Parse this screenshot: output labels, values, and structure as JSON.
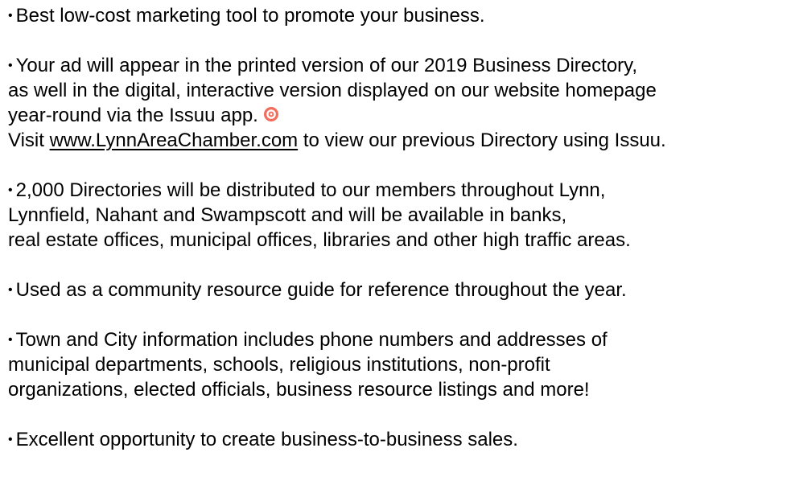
{
  "bullet": "•",
  "icon_color": "#f36d5d",
  "paragraphs": {
    "p1": {
      "l1": "Best low-cost marketing tool to promote your business."
    },
    "p2": {
      "l1": "Your ad will appear in the printed version of our 2019 Business Directory,",
      "l2": "as well in the digital, interactive version displayed on our website homepage",
      "l3": "year-round via the Issuu app.",
      "l3_icon": "issuu-icon",
      "l4_before": "Visit ",
      "l4_link": "www.LynnAreaChamber.com",
      "l4_after": " to view our previous Directory using Issuu."
    },
    "p3": {
      "l1": "2,000 Directories will be distributed to our members throughout Lynn,",
      "l2": "Lynnfield, Nahant and Swampscott and will be available in banks,",
      "l3": "real estate offices, municipal offices, libraries and other high traffic areas."
    },
    "p4": {
      "l1": "Used as a community resource guide for reference throughout the year."
    },
    "p5": {
      "l1": "Town and City information includes phone numbers and addresses of",
      "l2": "municipal departments, schools, religious institutions, non-profit",
      "l3": "organizations, elected officials, business resource listings and more!"
    },
    "p6": {
      "l1": "Excellent opportunity to create business-to-business sales."
    }
  }
}
